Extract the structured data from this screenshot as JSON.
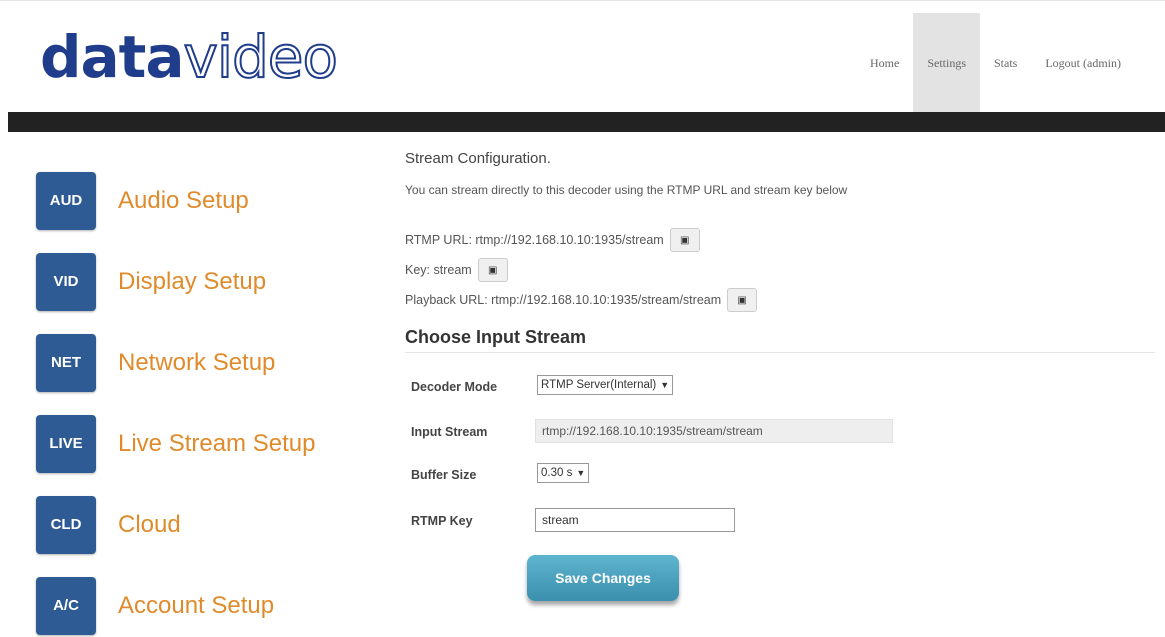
{
  "header": {
    "logo": {
      "bold": "data",
      "thin": "video"
    },
    "nav": [
      "Home",
      "Settings",
      "Stats",
      "Logout (admin)"
    ]
  },
  "sidebar": {
    "items": [
      {
        "badge": "AUD",
        "label": "Audio Setup"
      },
      {
        "badge": "VID",
        "label": "Display Setup"
      },
      {
        "badge": "NET",
        "label": "Network Setup"
      },
      {
        "badge": "LIVE",
        "label": "Live Stream Setup"
      },
      {
        "badge": "CLD",
        "label": "Cloud"
      },
      {
        "badge": "A/C",
        "label": "Account Setup"
      }
    ]
  },
  "stream_config": {
    "title": "Stream Configuration.",
    "description": "You can stream directly to this decoder using the RTMP URL and stream key below",
    "rtmp_url": "RTMP URL: rtmp://192.168.10.10:1935/stream",
    "key": "Key: stream",
    "playback_url": "Playback URL: rtmp://192.168.10.10:1935/stream/stream"
  },
  "input_stream": {
    "title": "Choose Input Stream",
    "decoder_mode_label": "Decoder Mode",
    "decoder_mode_value": "RTMP Server(Internal)",
    "input_stream_label": "Input Stream",
    "input_stream_value": "rtmp://192.168.10.10:1935/stream/stream",
    "buffer_size_label": "Buffer Size",
    "buffer_size_value": "0.30 s",
    "rtmp_key_label": "RTMP Key",
    "rtmp_key_value": "stream",
    "save_label": "Save Changes"
  },
  "colors": {
    "badge": "#2e5b93",
    "sidebar_label": "#e08b2b",
    "logo": "#1f3d8a",
    "save_button": "#4aa3c2"
  },
  "icons": {
    "copy": "copy-icon",
    "dropdown": "chevron-down-icon"
  }
}
